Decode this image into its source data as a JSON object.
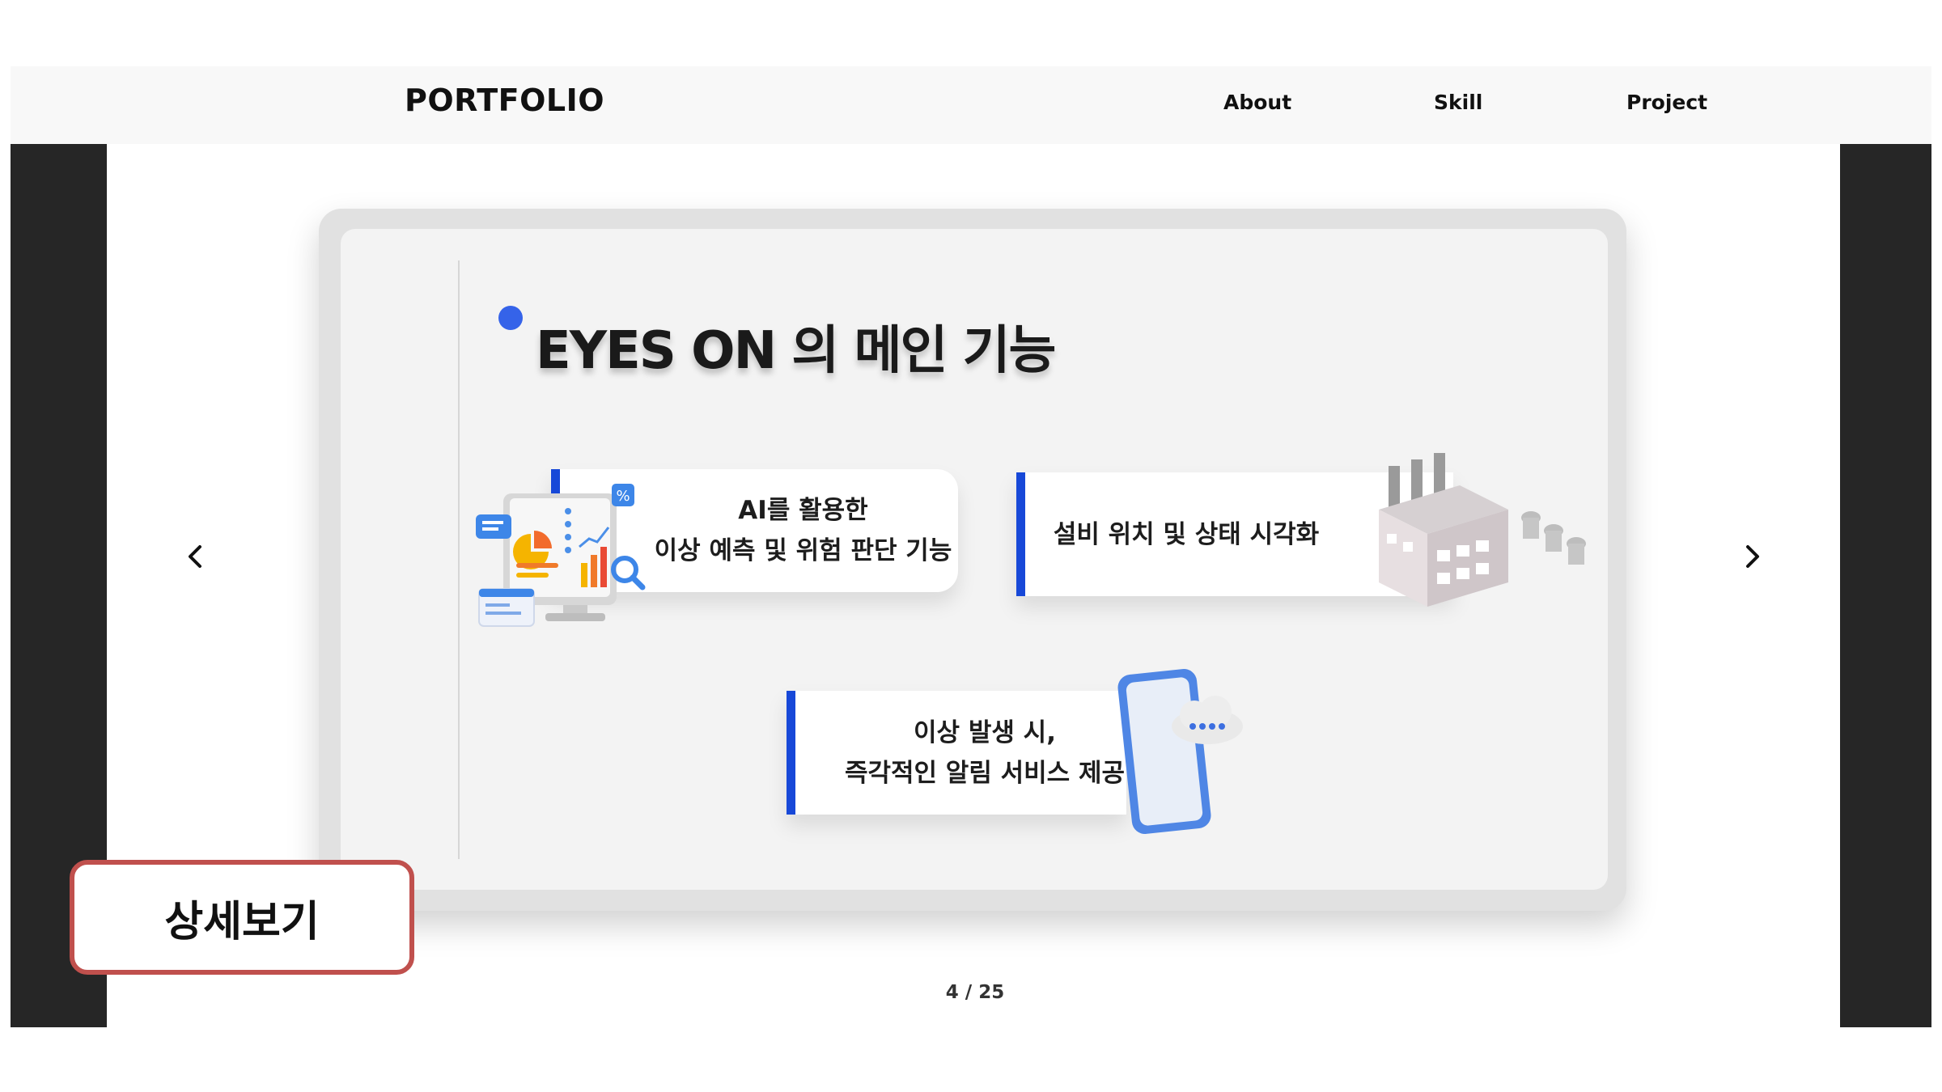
{
  "navbar": {
    "logo": "PORTFOLIO",
    "links": [
      {
        "label": "About"
      },
      {
        "label": "Skill"
      },
      {
        "label": "Project"
      }
    ]
  },
  "slide": {
    "title": "EYES ON 의 메인 기능",
    "features": [
      {
        "line1": "AI를 활용한",
        "line2": "이상 예측 및 위험 판단 기능",
        "icon": "analytics-dashboard-icon"
      },
      {
        "line1": "설비 위치 및 상태 시각화",
        "icon": "factory-icon"
      },
      {
        "line1": "이상 발생 시,",
        "line2": "즉각적인 알림 서비스 제공",
        "icon": "phone-notification-icon"
      }
    ]
  },
  "carousel": {
    "current": 4,
    "total": 25,
    "counter_text": "4 / 25",
    "prev_icon": "chevron-left-icon",
    "next_icon": "chevron-right-icon"
  },
  "detail_button": {
    "label": "상세보기"
  },
  "colors": {
    "accent_blue": "#1748d8",
    "title_dot": "#3563e9",
    "detail_border": "#c0504d",
    "side_panel": "#262626",
    "navbar_bg": "#f8f8f8"
  }
}
